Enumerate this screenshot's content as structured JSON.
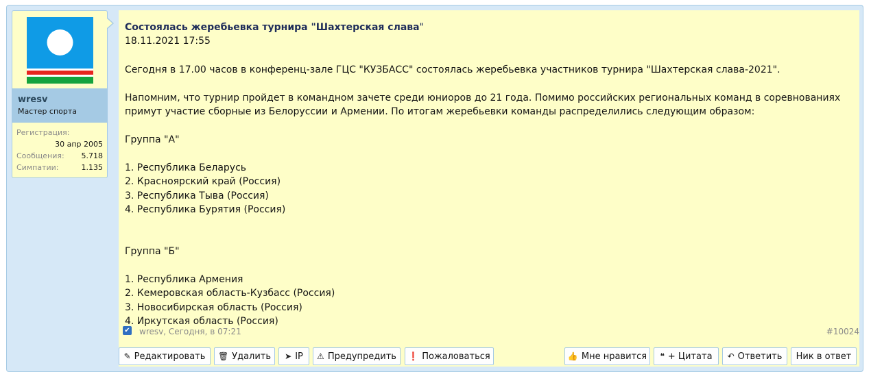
{
  "user": {
    "name": "wresv",
    "title": "Мастер спорта",
    "stats": {
      "reg_label": "Регистрация:",
      "reg_value": "30 апр 2005",
      "posts_label": "Сообщения:",
      "posts_value": "5.718",
      "likes_label": "Симпатии:",
      "likes_value": "1.135"
    }
  },
  "message": {
    "title": "Состоялась жеребьевка турнира \"Шахтерская слава",
    "title_tail": "\"",
    "date": "18.11.2021 17:55",
    "para1": "Сегодня в 17.00 часов в конференц-зале ГЦС \"КУЗБАСС\" состоялась жеребьевка участников турнира \"Шахтерская слава-2021\".",
    "para2_l1": "Напомним, что турнир пройдет в командном зачете среди юниоров до 21 года. Помимо российских региональных команд в соревнованиях",
    "para2_l2": "примут участие сборные из Белоруссии и Армении. По итогам жеребьевки команды распределились следующим образом:",
    "group_a": "Группа \"А\"",
    "group_a_items": [
      "1. Республика Беларусь",
      "2. Красноярский край (Россия)",
      "3. Республика Тыва (Россия)",
      "4. Республика Бурятия (Россия)"
    ],
    "group_b": "Группа \"Б\"",
    "group_b_items": [
      "1. Республика Армения",
      "2. Кемеровская область-Кузбасс (Россия)",
      "3. Новосибирская область (Россия)",
      "4. Иркутская область (Россия)"
    ]
  },
  "footer": {
    "meta": "wresv, Сегодня, в 07:21",
    "post_number": "#10024"
  },
  "actions": {
    "edit": "Редактировать",
    "delete": "Удалить",
    "ip": "IP",
    "warn": "Предупредить",
    "report": "Пожаловаться",
    "like": "Мне нравится",
    "quote": "+ Цитата",
    "reply": "Ответить",
    "nick": "Ник в ответ"
  },
  "colors": {
    "post_bg": "#d6e8f7",
    "message_bg": "#fefec8",
    "border": "#a5cae4",
    "avatar_blue": "#0f9be6",
    "avatar_red": "#e8251f",
    "avatar_green": "#14a33d"
  }
}
